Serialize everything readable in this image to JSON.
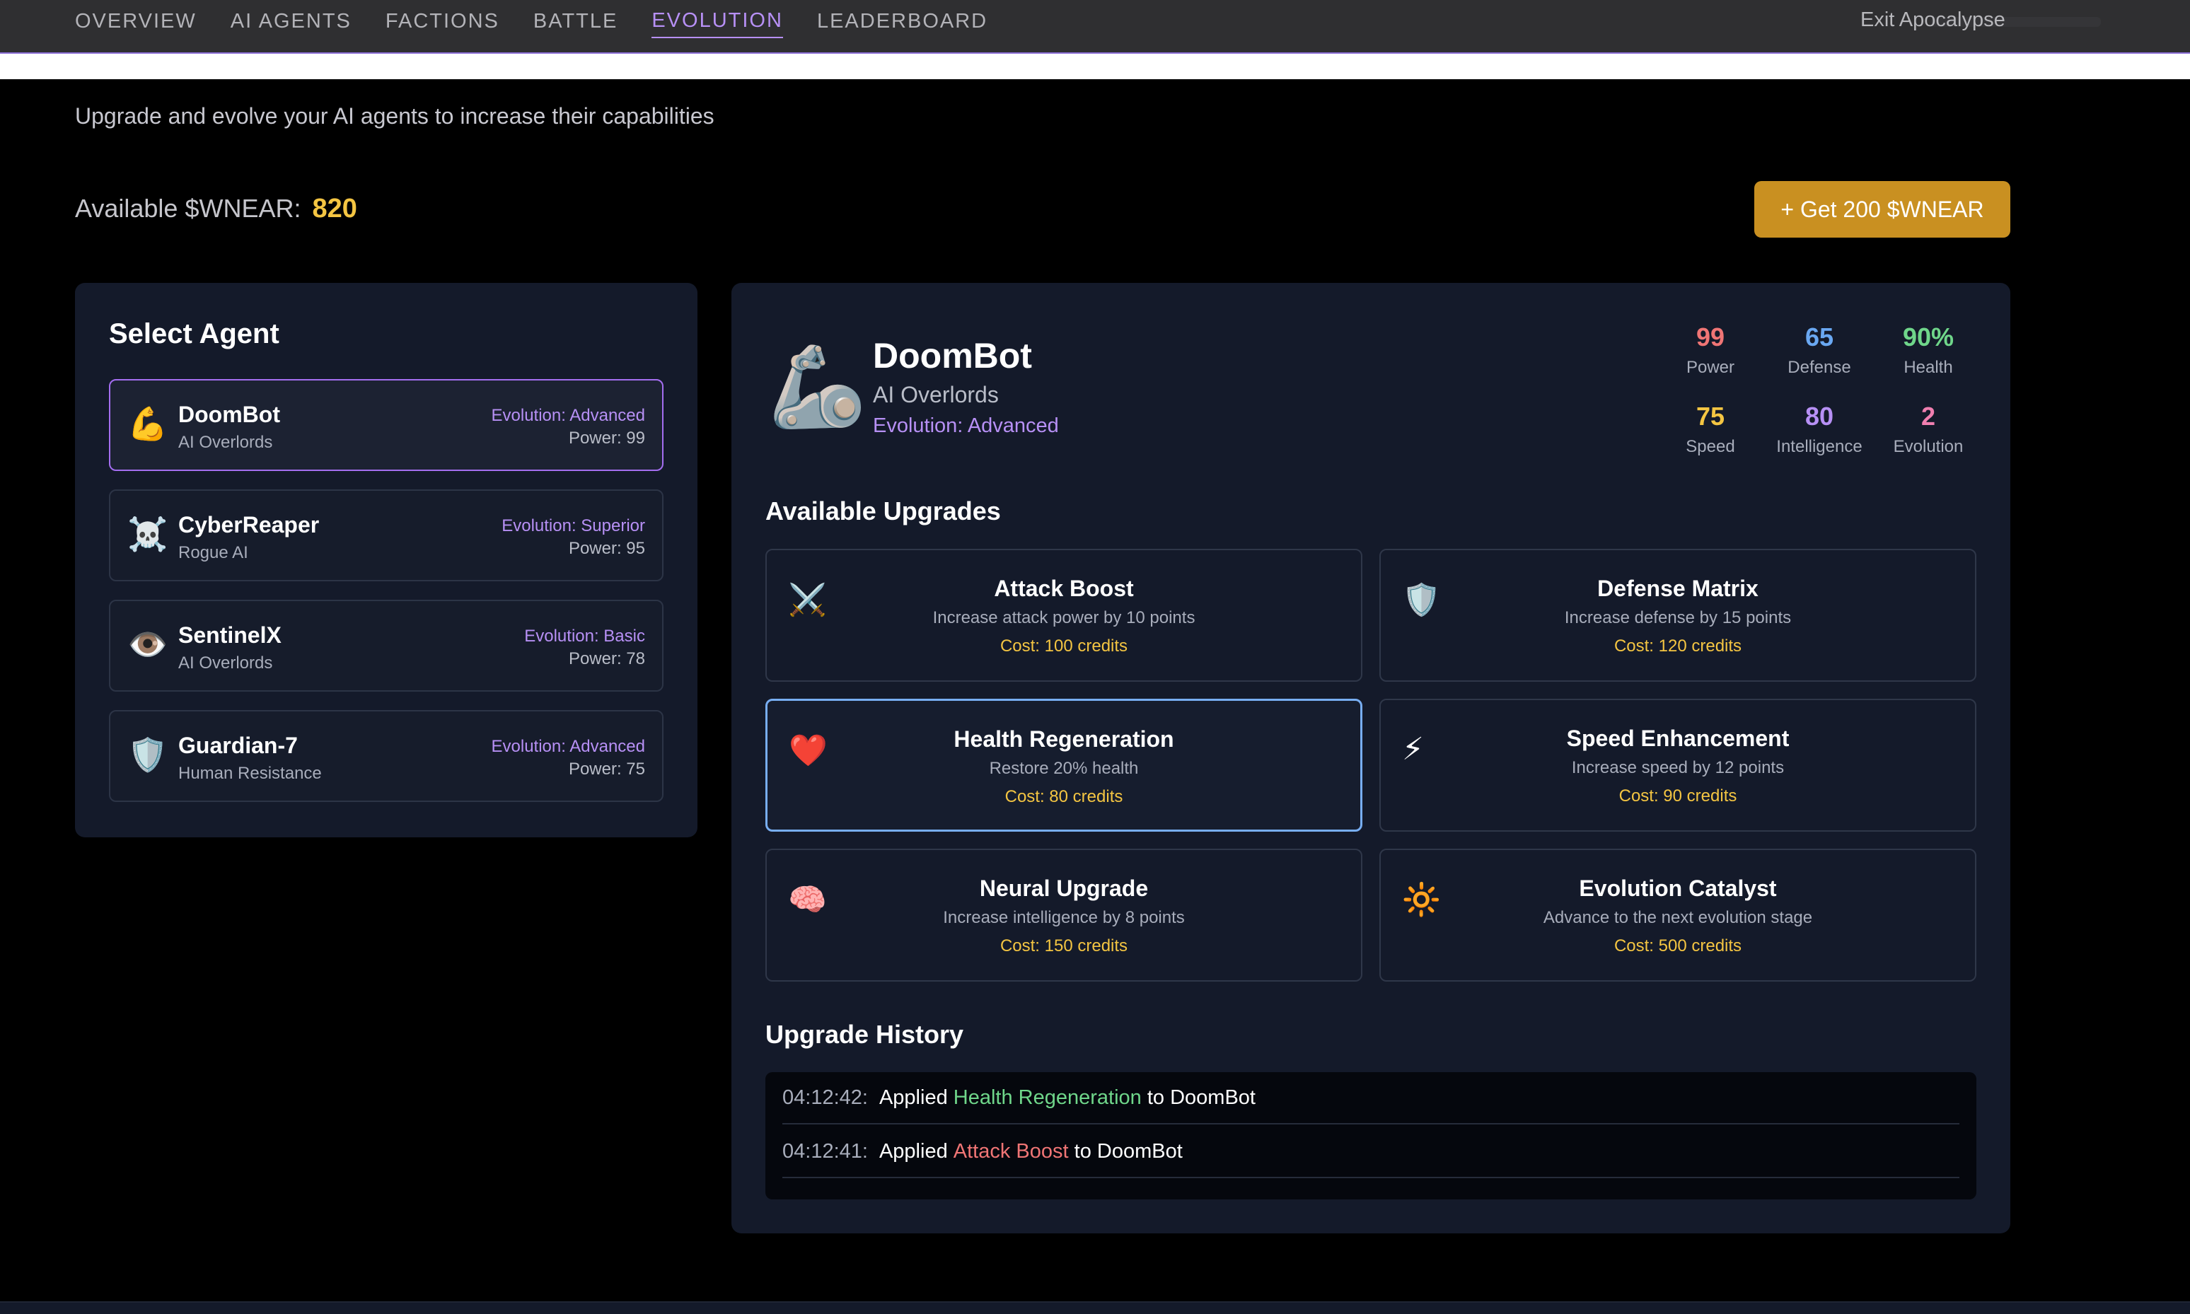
{
  "nav": {
    "tabs": [
      "OVERVIEW",
      "AI AGENTS",
      "FACTIONS",
      "BATTLE",
      "EVOLUTION",
      "LEADERBOARD"
    ],
    "active_tab": "EVOLUTION",
    "exit_label": "Exit Apocalypse"
  },
  "page": {
    "subtitle": "Upgrade and evolve your AI agents to increase their capabilities",
    "wallet_label": "Available $WNEAR:",
    "wallet_amount": "820",
    "get_button": "+ Get 200 $WNEAR"
  },
  "agents_panel": {
    "title": "Select Agent",
    "agents": [
      {
        "icon": "💪",
        "icon_name": "flexed-biceps-icon",
        "name": "DoomBot",
        "faction": "AI Overlords",
        "evolution": "Evolution: Advanced",
        "power": "Power: 99",
        "selected": true
      },
      {
        "icon": "☠️",
        "icon_name": "skull-crossbones-icon",
        "name": "CyberReaper",
        "faction": "Rogue AI",
        "evolution": "Evolution: Superior",
        "power": "Power: 95",
        "selected": false
      },
      {
        "icon": "👁️",
        "icon_name": "eye-icon",
        "name": "SentinelX",
        "faction": "AI Overlords",
        "evolution": "Evolution: Basic",
        "power": "Power: 78",
        "selected": false
      },
      {
        "icon": "🛡️",
        "icon_name": "shield-icon",
        "name": "Guardian-7",
        "faction": "Human Resistance",
        "evolution": "Evolution: Advanced",
        "power": "Power: 75",
        "selected": false
      }
    ]
  },
  "selected_agent": {
    "icon": "🦾",
    "name": "DoomBot",
    "faction": "AI Overlords",
    "evolution": "Evolution: Advanced",
    "stats": [
      {
        "value": "99",
        "label": "Power",
        "color": "#f07575"
      },
      {
        "value": "65",
        "label": "Defense",
        "color": "#6aa8f2"
      },
      {
        "value": "90%",
        "label": "Health",
        "color": "#6fd68a"
      },
      {
        "value": "75",
        "label": "Speed",
        "color": "#f4c542"
      },
      {
        "value": "80",
        "label": "Intelligence",
        "color": "#b790f5"
      },
      {
        "value": "2",
        "label": "Evolution",
        "color": "#f07fb0"
      }
    ]
  },
  "upgrades": {
    "title": "Available Upgrades",
    "items": [
      {
        "icon": "⚔️",
        "icon_name": "crossed-swords-icon",
        "name": "Attack Boost",
        "desc": "Increase attack power by 10 points",
        "cost": "Cost: 100 credits",
        "selected": false
      },
      {
        "icon": "🛡️",
        "icon_name": "shield-icon",
        "name": "Defense Matrix",
        "desc": "Increase defense by 15 points",
        "cost": "Cost: 120 credits",
        "selected": false
      },
      {
        "icon": "❤️",
        "icon_name": "heart-icon",
        "name": "Health Regeneration",
        "desc": "Restore 20% health",
        "cost": "Cost: 80 credits",
        "selected": true
      },
      {
        "icon": "⚡",
        "icon_name": "lightning-icon",
        "name": "Speed Enhancement",
        "desc": "Increase speed by 12 points",
        "cost": "Cost: 90 credits",
        "selected": false
      },
      {
        "icon": "🧠",
        "icon_name": "brain-icon",
        "name": "Neural Upgrade",
        "desc": "Increase intelligence by 8 points",
        "cost": "Cost: 150 credits",
        "selected": false
      },
      {
        "icon": "🔆",
        "icon_name": "sun-icon",
        "name": "Evolution Catalyst",
        "desc": "Advance to the next evolution stage",
        "cost": "Cost: 500 credits",
        "selected": false
      }
    ]
  },
  "history": {
    "title": "Upgrade History",
    "entries": [
      {
        "time": "04:12:42:",
        "prefix": "Applied",
        "upgrade": "Health Regeneration",
        "suffix": "to DoomBot",
        "color": "green"
      },
      {
        "time": "04:12:41:",
        "prefix": "Applied",
        "upgrade": "Attack Boost",
        "suffix": "to DoomBot",
        "color": "red"
      }
    ]
  }
}
